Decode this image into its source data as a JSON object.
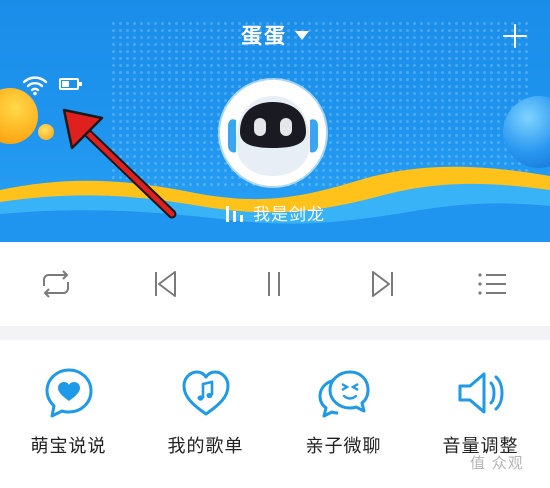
{
  "header": {
    "device_name": "蛋蛋",
    "now_playing": "我是剑龙",
    "colors": {
      "banner": "#1f95ef",
      "accent_yellow": "#ffc21a",
      "icon_blue": "#1e9ae8"
    }
  },
  "status_icons": [
    "wifi-icon",
    "battery-icon"
  ],
  "player_controls": [
    {
      "name": "repeat-icon"
    },
    {
      "name": "previous-icon"
    },
    {
      "name": "pause-icon"
    },
    {
      "name": "next-icon"
    },
    {
      "name": "playlist-icon"
    }
  ],
  "features": [
    {
      "label": "萌宝说说",
      "icon": "heart-chat-icon"
    },
    {
      "label": "我的歌单",
      "icon": "heart-music-icon"
    },
    {
      "label": "亲子微聊",
      "icon": "wink-chat-icon"
    },
    {
      "label": "音量调整",
      "icon": "speaker-icon"
    }
  ],
  "watermark": "值 众观"
}
